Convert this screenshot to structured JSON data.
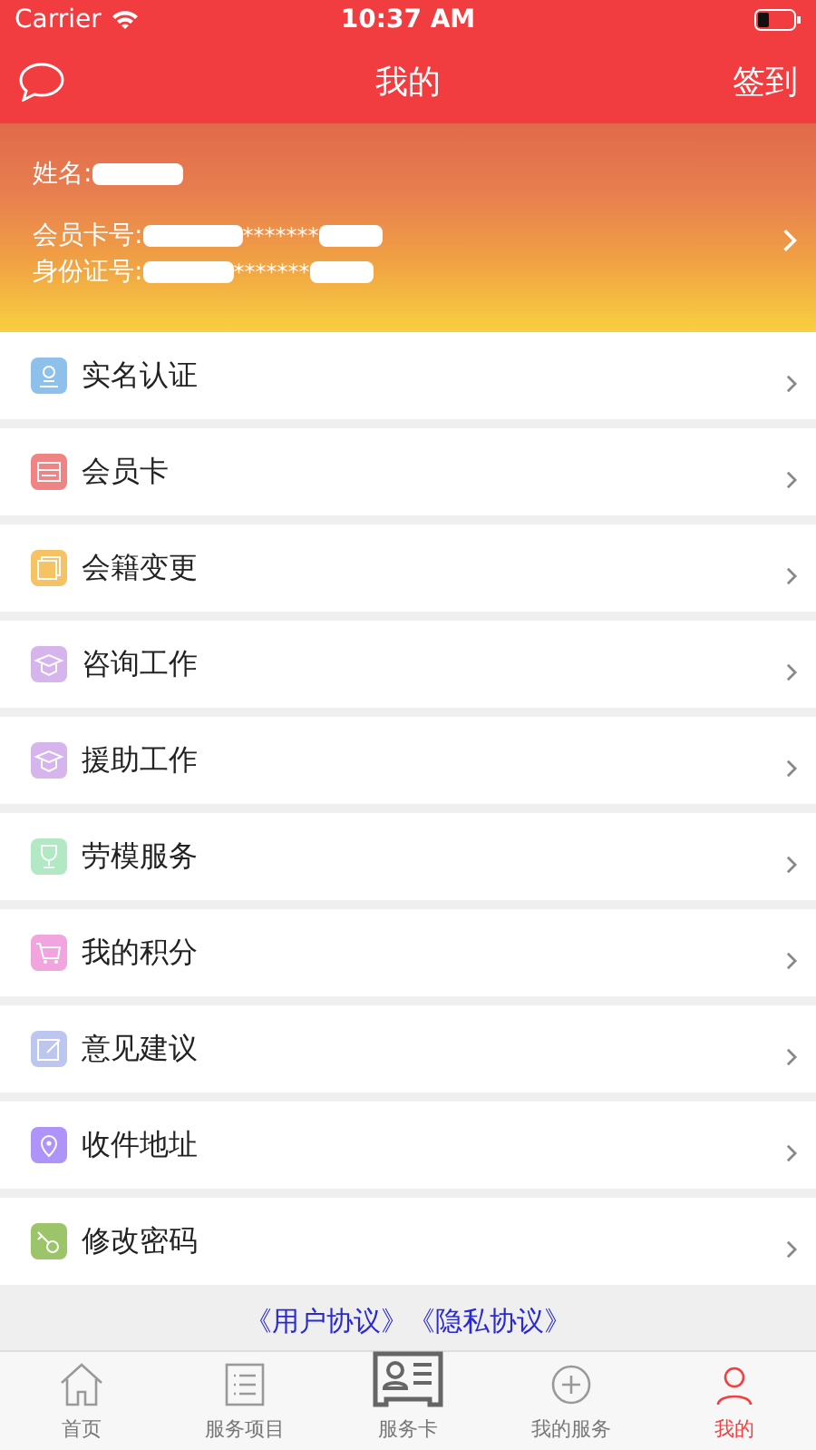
{
  "status_bar": {
    "carrier": "Carrier",
    "time": "10:37 AM"
  },
  "nav_bar": {
    "title": "我的",
    "action": "签到"
  },
  "profile": {
    "name_label": "姓名:",
    "card_label": "会员卡号:",
    "card_value": "*******",
    "id_label": "身份证号:",
    "id_value": "*******"
  },
  "menu": [
    {
      "label": "实名认证",
      "color": "#8ec0ec"
    },
    {
      "label": "会员卡",
      "color": "#f08484"
    },
    {
      "label": "会籍变更",
      "color": "#f5c264"
    },
    {
      "label": "咨询工作",
      "color": "#d6b4ec"
    },
    {
      "label": "援助工作",
      "color": "#d6b4ec"
    },
    {
      "label": "劳模服务",
      "color": "#b2e8c4"
    },
    {
      "label": "我的积分",
      "color": "#f2a4de"
    },
    {
      "label": "意见建议",
      "color": "#bcc6ee"
    },
    {
      "label": "收件地址",
      "color": "#ae94f8"
    },
    {
      "label": "修改密码",
      "color": "#9cc468"
    }
  ],
  "footer_links": "《用户协议》《隐私协议》",
  "tab_bar": [
    {
      "label": "首页",
      "selected": false
    },
    {
      "label": "服务项目",
      "selected": false
    },
    {
      "label": "服务卡",
      "selected": false
    },
    {
      "label": "我的服务",
      "selected": false
    },
    {
      "label": "我的",
      "selected": true
    }
  ]
}
